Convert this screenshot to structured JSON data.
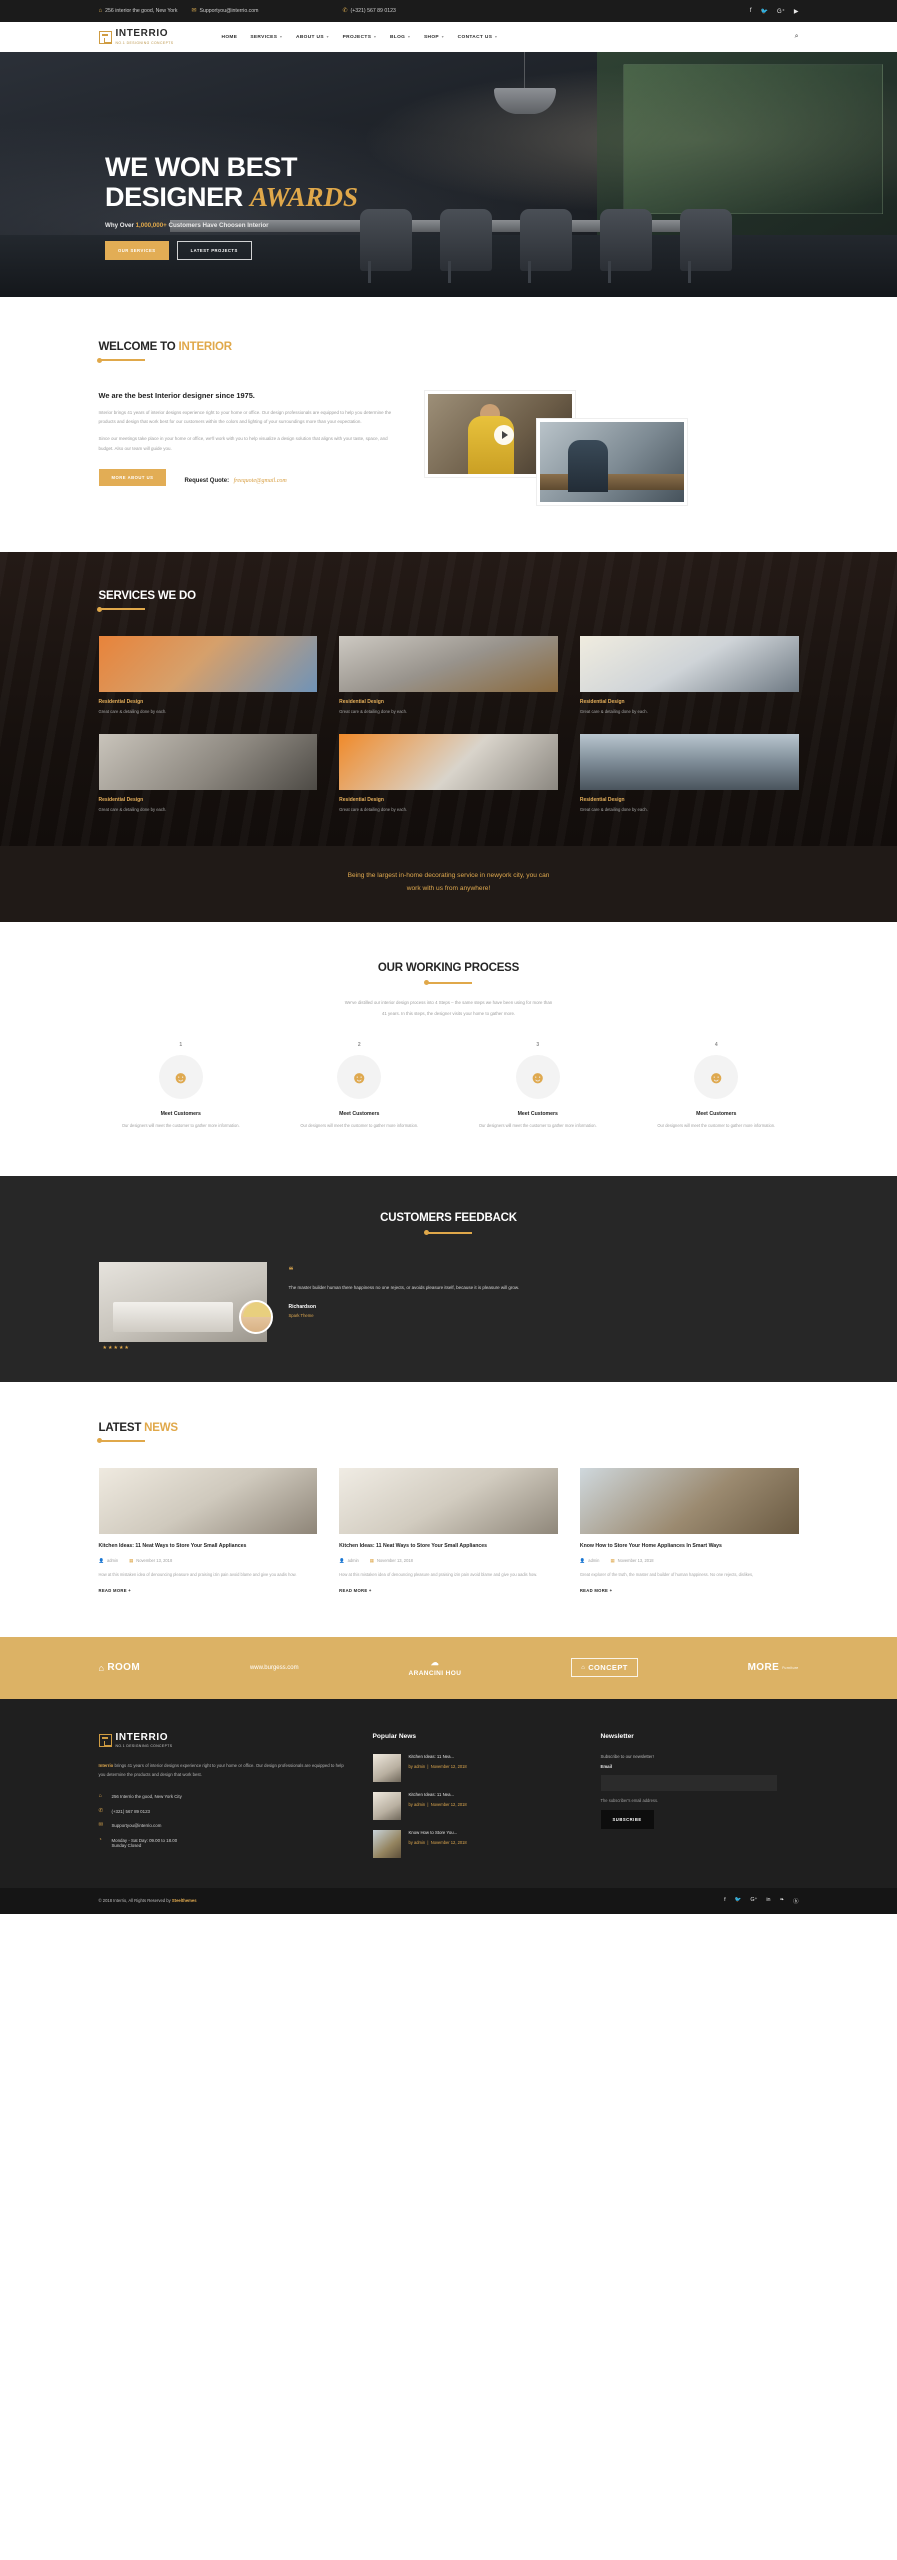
{
  "topbar": {
    "address": "256 interior the good, New York",
    "email": "Supportyou@interrio.com",
    "phone": "(+321) 567 89 0123",
    "socials": [
      "facebook-icon",
      "twitter-icon",
      "google-plus-icon",
      "youtube-icon"
    ]
  },
  "brand": {
    "name": "INTERRIO",
    "tagline": "NO.1 DESIGNING CONCEPTS"
  },
  "nav": {
    "items": [
      {
        "label": "HOME",
        "has_caret": false
      },
      {
        "label": "SERVICES",
        "has_caret": true
      },
      {
        "label": "ABOUT US",
        "has_caret": true
      },
      {
        "label": "PROJECTS",
        "has_caret": true
      },
      {
        "label": "BLOG",
        "has_caret": true
      },
      {
        "label": "SHOP",
        "has_caret": true
      },
      {
        "label": "CONTACT US",
        "has_caret": true
      }
    ],
    "search_icon": "search-icon"
  },
  "hero": {
    "line1": "WE WON BEST",
    "line2": "DESIGNER",
    "accent": "AWARDS",
    "sub_before": "Why Over ",
    "sub_highlight": "1,000,000+",
    "sub_after": " Customers Have Choosen Interior",
    "btn_primary": "OUR SERVICES",
    "btn_secondary": "LATEST PROJECTS"
  },
  "welcome": {
    "title_main": "WELCOME TO ",
    "title_accent": "INTERIOR",
    "heading": "We are the best Interior designer since 1975.",
    "paragraph1": "Interior brings 41 years of interior designs experience right to your home or office. Our design professionals are equipped to help you determine the products and design that work best for our customers within the colors and lighting of your surroundings more than your expectation.",
    "paragraph2": "Since our meetings take place in your home or office, we'll work with you to help visualize a design solution that aligns with your taste, space, and budget. Also our team will guide you.",
    "button": "MORE ABOUT US",
    "quote_label": "Request Quote:",
    "quote_email": "freequote@gmail.com"
  },
  "services": {
    "title": "SERVICES WE DO",
    "cards": [
      {
        "title": "Residential Design",
        "desc": "Great care & detailing done by each.",
        "thumb": "t1"
      },
      {
        "title": "Residential Design",
        "desc": "Great care & detailing done by each.",
        "thumb": "t2"
      },
      {
        "title": "Residential Design",
        "desc": "Great care & detailing done by each.",
        "thumb": "t3"
      },
      {
        "title": "Residential Design",
        "desc": "Great care & detailing done by each.",
        "thumb": "t4"
      },
      {
        "title": "Residential Design",
        "desc": "Great care & detailing done by each.",
        "thumb": "t5"
      },
      {
        "title": "Residential Design",
        "desc": "Great care & detailing done by each.",
        "thumb": "t6"
      }
    ]
  },
  "banner": {
    "line1": "Being the largest in-home decorating service in newyork city, you can",
    "line2": "work with us from anywhere!"
  },
  "process": {
    "title": "OUR WORKING PROCESS",
    "lead1": "We've distilled our interior design process into 4 Steps – the same steps we have been using for more than",
    "lead2": "41 years. In this steps, the designer visits your home to gather more.",
    "steps": [
      {
        "num": "1",
        "title": "Meet Customers",
        "desc": "Our designers will meet the customer to gather more information."
      },
      {
        "num": "2",
        "title": "Meet Customers",
        "desc": "Our designers will meet the customer to gather more information."
      },
      {
        "num": "3",
        "title": "Meet Customers",
        "desc": "Our designers will meet the customer to gather more information."
      },
      {
        "num": "4",
        "title": "Meet Customers",
        "desc": "Our designers will meet the customer to gather more information."
      }
    ]
  },
  "feedback": {
    "title": "CUSTOMERS FEEDBACK",
    "quote": "The master builder human there happiness no one rejects, or avoids pleasure itself, because it is pleasure will grow.",
    "name": "Richardson",
    "role": "Spark Theme",
    "stars": "★★★★★"
  },
  "news": {
    "title_main": "LATEST ",
    "title_accent": "NEWS",
    "posts": [
      {
        "title": "Kitchen Ideas: 11 Neat Ways to Store Your Small Appliances",
        "author": "admin",
        "date": "November 13, 2018",
        "excerpt": "How at this mistaken idea of denouncing pleasure and praising izin pain avoid blame and give you aadis how.",
        "more": "READ MORE +",
        "thumb": "n1"
      },
      {
        "title": "Kitchen Ideas: 11 Neat Ways to Store Your Small Appliances",
        "author": "admin",
        "date": "November 13, 2018",
        "excerpt": "How at this mistaken idea of denouncing pleasure and praising izin pain avoid blame and give you aadis how.",
        "more": "READ MORE +",
        "thumb": "n2"
      },
      {
        "title": "Know How to Store Your Home Appliances In Smart Ways",
        "author": "admin",
        "date": "November 13, 2018",
        "excerpt": "Great explorer of the truth, the master and builder of human happiness. No one rejects, dislikes,",
        "more": "READ MORE +",
        "thumb": "n3"
      }
    ]
  },
  "brands": [
    {
      "label": "ROOM",
      "style": "icon"
    },
    {
      "label": "www.burgess.com",
      "style": "small"
    },
    {
      "label": "ARANCINI HOU",
      "style": "cloud"
    },
    {
      "label": "CONCEPT",
      "style": "box"
    },
    {
      "label": "MORE",
      "style": "sub",
      "sub": "Furniture"
    }
  ],
  "footer": {
    "about_bold": "Interrio",
    "about_rest": " brings 41 years of interior designs experience right to your home or office. Our design professionals are equipped to help you determine the products and design that work best.",
    "contact": [
      {
        "icon": "location-icon",
        "text": "256 Interrio the good, New York City"
      },
      {
        "icon": "phone-icon",
        "text": "(+321) 567 89 0123"
      },
      {
        "icon": "mail-icon",
        "text": "Supportyou@interrio.com"
      },
      {
        "icon": "clock-icon",
        "text": "Monday - Sat Day: 09.00 to 18.00"
      },
      {
        "icon": "blank-icon",
        "text": "Sunday Closed"
      }
    ],
    "popular_news_title": "Popular News",
    "popular_news": [
      {
        "title": "Kitchen Ideas: 11 Nea...",
        "author": "by admin",
        "date": "November 12, 2018"
      },
      {
        "title": "Kitchen Ideas: 11 Nea...",
        "author": "by admin",
        "date": "November 12, 2018"
      },
      {
        "title": "Know How to Store You...",
        "author": "by admin",
        "date": "November 12, 2018"
      }
    ],
    "newsletter_title": "Newsletter",
    "newsletter_sub": "Subscribe to our newsletter!",
    "email_label": "Email",
    "email_value": "",
    "email_placeholder": "",
    "email_help": "The subscriber's email address.",
    "subscribe_button": "SUBSCRIBE"
  },
  "copyright": {
    "text_before": "© 2018 Interrio, All Rights Reserved by ",
    "text_brand": "Steelthemes",
    "socials": [
      "facebook-icon",
      "twitter-icon",
      "google-plus-icon",
      "linkedin-icon",
      "rss-icon",
      "behance-icon"
    ]
  },
  "colors": {
    "gold": "#dfa94f",
    "dark": "#1f1f1f",
    "banner_gold": "#dcb265"
  }
}
